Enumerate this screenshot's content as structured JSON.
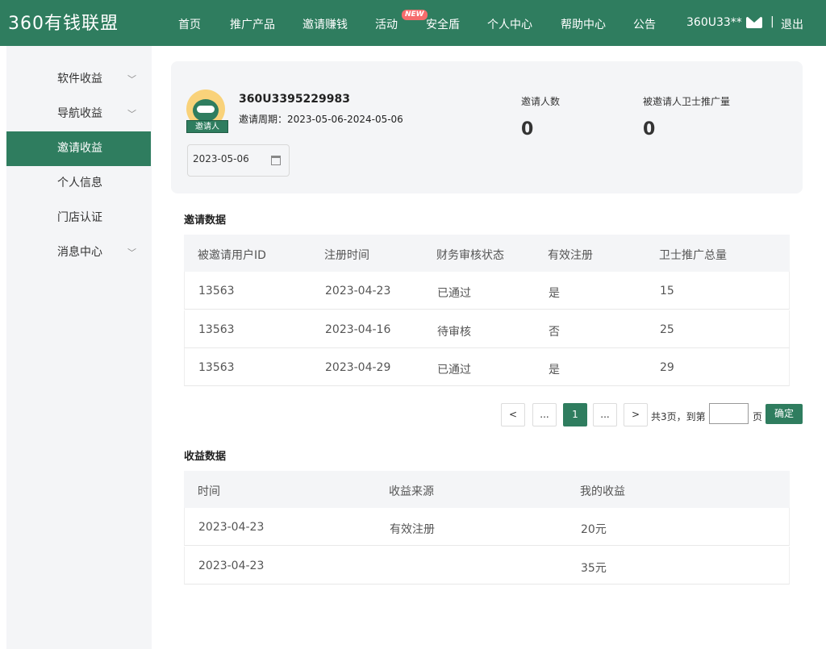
{
  "header": {
    "logo": "360有钱联盟",
    "nav": [
      "首页",
      "推广产品",
      "邀请赚钱",
      "活动",
      "安全盾",
      "个人中心",
      "帮助中心",
      "公告"
    ],
    "new_badge": "NEW",
    "username": "360U33**",
    "separator": "|",
    "logout": "退出"
  },
  "sidebar": {
    "items": [
      {
        "label": "软件收益",
        "chevron": "﹀"
      },
      {
        "label": "导航收益",
        "chevron": "﹀"
      },
      {
        "label": "邀请收益"
      },
      {
        "label": "个人信息"
      },
      {
        "label": "门店认证"
      },
      {
        "label": "消息中心",
        "chevron": "﹀"
      }
    ]
  },
  "profile": {
    "avatar_tag": "邀请人",
    "uid": "360U3395229983",
    "period": "邀请周期：2023-05-06-2024-05-06",
    "date_value": "2023-05-06",
    "stats": [
      {
        "label": "邀请人数",
        "value": "0"
      },
      {
        "label": "被邀请人卫士推广量",
        "value": "0"
      }
    ]
  },
  "invite": {
    "title": "邀请数据",
    "columns": [
      "被邀请用户ID",
      "注册时间",
      "财务审核状态",
      "有效注册",
      "卫士推广总量"
    ],
    "rows": [
      [
        "13563",
        "2023-04-23",
        "已通过",
        "是",
        "15"
      ],
      [
        "13563",
        "2023-04-16",
        "待审核",
        "否",
        "25"
      ],
      [
        "13563",
        "2023-04-29",
        "已通过",
        "是",
        "29"
      ]
    ]
  },
  "pager": {
    "prev": "<",
    "ellipsis_left": "...",
    "current": "1",
    "ellipsis_right": "...",
    "next": ">",
    "total": "共3页，到第",
    "page_unit": "页",
    "confirm": "确定"
  },
  "income": {
    "title": "收益数据",
    "columns": [
      "时间",
      "收益来源",
      "我的收益"
    ],
    "rows": [
      [
        "2023-04-23",
        "有效注册",
        "20元"
      ],
      [
        "2023-04-23",
        "",
        "35元"
      ]
    ]
  },
  "colors": {
    "brand": "#2f7d5f",
    "panel": "#f4f5f7"
  }
}
